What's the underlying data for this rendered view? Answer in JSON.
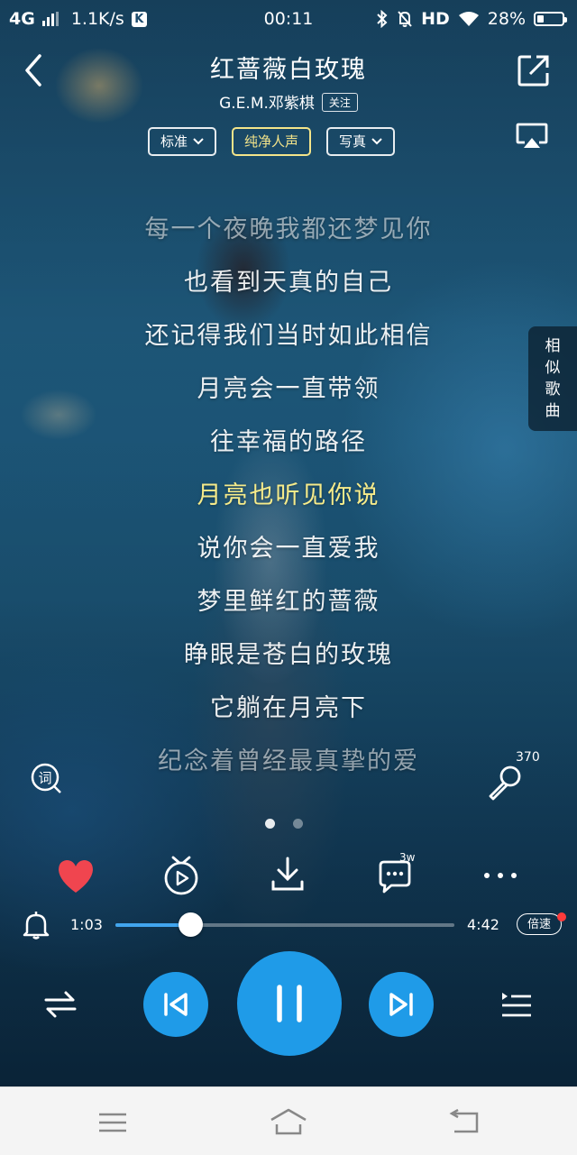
{
  "status_bar": {
    "network": "4G",
    "speed": "1.1K/s",
    "app_badge": "K",
    "time": "00:11",
    "hd": "HD",
    "battery_percent": "28%",
    "battery_level": 0.28
  },
  "header": {
    "song_title": "红蔷薇白玫瑰",
    "artist": "G.E.M.邓紫棋",
    "follow_label": "关注",
    "icons": [
      "back-icon",
      "share-icon",
      "cast-icon"
    ]
  },
  "chips": [
    {
      "label": "标准",
      "has_dropdown": true
    },
    {
      "label": "纯净人声",
      "has_dropdown": false,
      "active": true
    },
    {
      "label": "写真",
      "has_dropdown": true
    }
  ],
  "lyrics": {
    "lines": [
      "每一个夜晚我都还梦见你",
      "也看到天真的自己",
      "还记得我们当时如此相信",
      "月亮会一直带领",
      "往幸福的路径",
      "月亮也听见你说",
      "说你会一直爱我",
      "梦里鲜红的蔷薇",
      "睁眼是苍白的玫瑰",
      "它躺在月亮下",
      "纪念着曾经最真挚的爱"
    ],
    "current_index": 5
  },
  "similar_songs": [
    "相",
    "似",
    "歌",
    "曲"
  ],
  "karaoke": {
    "count": "370"
  },
  "page_indicator": {
    "total": 2,
    "active": 0
  },
  "actions": {
    "comment_count": "3w",
    "icons": [
      "heart-icon",
      "radio-icon",
      "download-icon",
      "comment-icon",
      "more-icon"
    ],
    "heart_color": "#f0454f"
  },
  "progress": {
    "current_time": "1:03",
    "total_time": "4:42",
    "fraction": 0.2234,
    "speed_label": "倍速",
    "accent": "#1f9be8"
  },
  "transport": {
    "icons": [
      "shuffle-icon",
      "previous-icon",
      "pause-icon",
      "next-icon",
      "playlist-icon"
    ]
  },
  "navbar": {
    "icons": [
      "menu-icon",
      "home-icon",
      "back-nav-icon"
    ]
  }
}
